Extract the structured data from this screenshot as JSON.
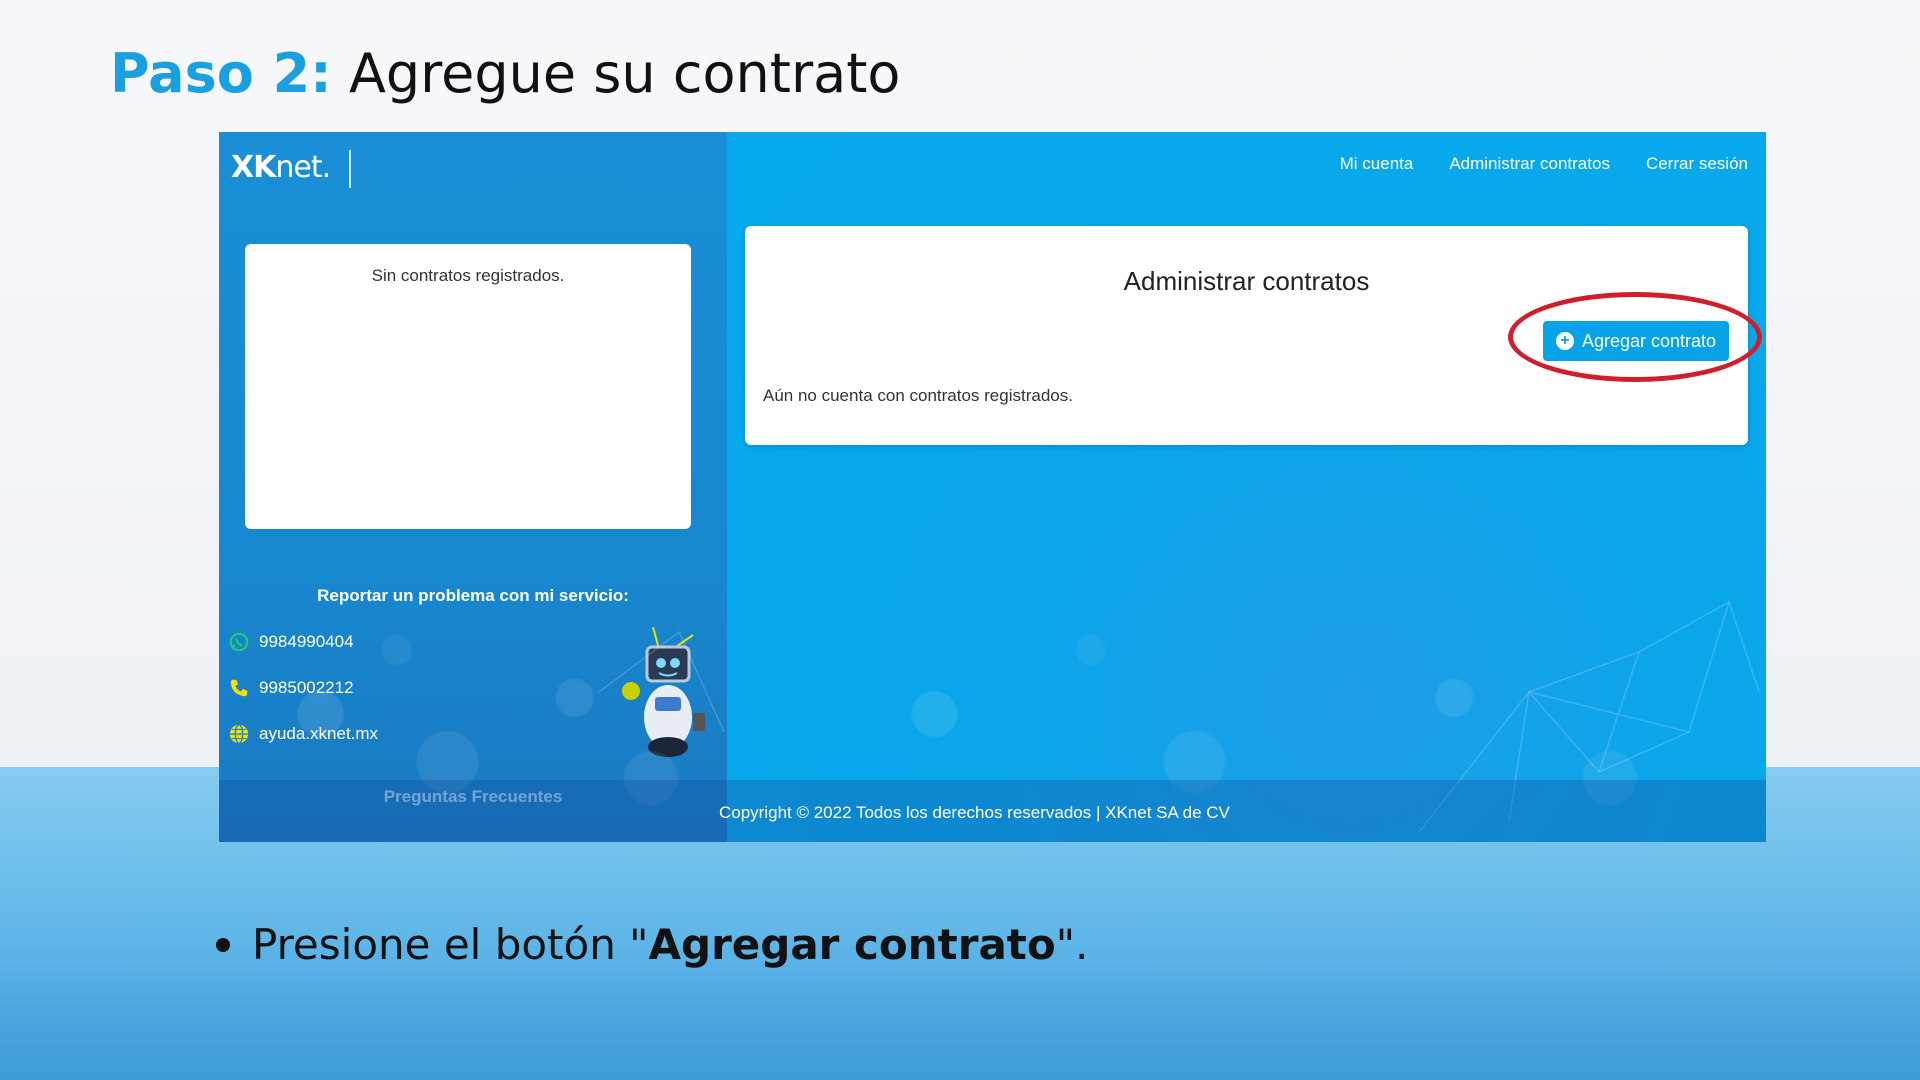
{
  "slide": {
    "title_step": "Paso 2:",
    "title_rest": "Agregue su contrato",
    "instruction_prefix": "Presione el botón \"",
    "instruction_bold": "Agregar contrato",
    "instruction_suffix": "\"."
  },
  "app": {
    "logo": {
      "text_bold": "XK",
      "text_rest": "net."
    },
    "nav": {
      "my_account": "Mi cuenta",
      "manage_contracts": "Administrar contratos",
      "logout": "Cerrar sesión"
    },
    "sidebar": {
      "contracts_empty": "Sin contratos registrados.",
      "report_title": "Reportar un problema con mi servicio:",
      "contacts": [
        {
          "icon": "whatsapp-icon",
          "text": "9984990404"
        },
        {
          "icon": "phone-icon",
          "text": "9985002212"
        },
        {
          "icon": "globe-icon",
          "text": "ayuda.xknet.mx"
        }
      ],
      "faq": "Preguntas Frecuentes"
    },
    "panel": {
      "title": "Administrar contratos",
      "add_button": "Agregar contrato",
      "empty_message": "Aún no cuenta con contratos registrados."
    },
    "footer": "Copyright © 2022 Todos los derechos reservados | XKnet SA de CV"
  },
  "colors": {
    "accent": "#1a9fe0",
    "button": "#07a3e8",
    "highlight": "#d01f2a",
    "app_blue": "#06aaed"
  }
}
